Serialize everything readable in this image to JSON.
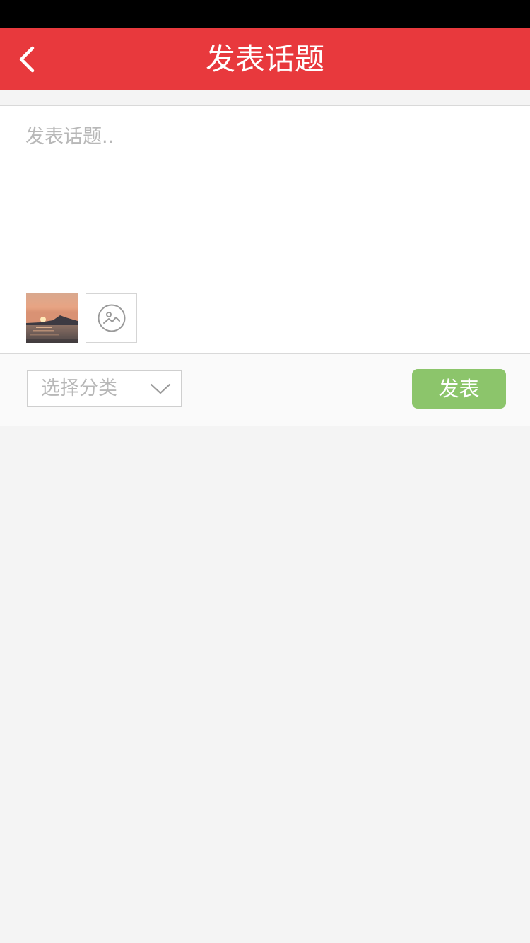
{
  "header": {
    "title": "发表话题",
    "background_color": "#e8393d",
    "back_icon": "chevron-left-icon"
  },
  "composer": {
    "placeholder": "发表话题..",
    "value": "",
    "attached_images": [
      {
        "description_icon": "sunset-photo-thumbnail"
      }
    ],
    "add_image_icon": "image-add-icon"
  },
  "actions": {
    "category_placeholder": "选择分类",
    "category_icon": "chevron-down-icon",
    "publish_label": "发表",
    "publish_color": "#8cc56b"
  }
}
